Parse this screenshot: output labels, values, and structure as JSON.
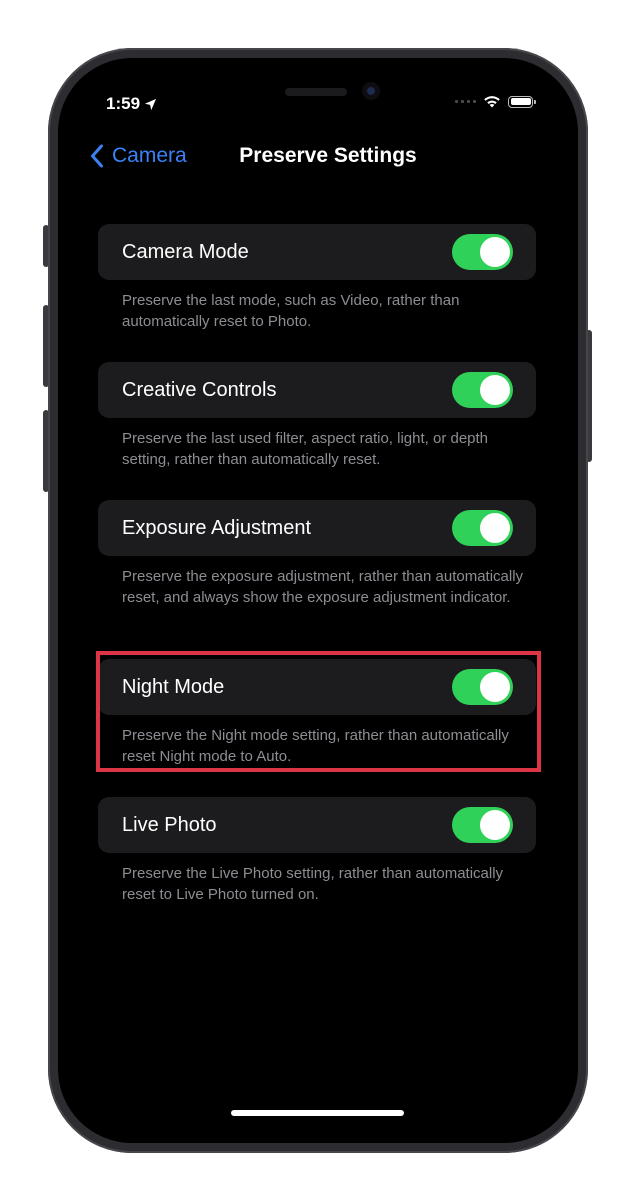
{
  "status_bar": {
    "time": "1:59"
  },
  "nav": {
    "back_label": "Camera",
    "title": "Preserve Settings"
  },
  "settings": [
    {
      "label": "Camera Mode",
      "enabled": true,
      "footer": "Preserve the last mode, such as Video, rather than automatically reset to Photo."
    },
    {
      "label": "Creative Controls",
      "enabled": true,
      "footer": "Preserve the last used filter, aspect ratio, light, or depth setting, rather than automatically reset."
    },
    {
      "label": "Exposure Adjustment",
      "enabled": true,
      "footer": "Preserve the exposure adjustment, rather than automatically reset, and always show the exposure adjustment indicator."
    },
    {
      "label": "Night Mode",
      "enabled": true,
      "highlighted": true,
      "footer": "Preserve the Night mode setting, rather than automatically reset Night mode to Auto."
    },
    {
      "label": "Live Photo",
      "enabled": true,
      "footer": "Preserve the Live Photo setting, rather than automatically reset to Live Photo turned on."
    }
  ],
  "icons": {
    "location": "location-arrow-icon",
    "wifi": "wifi-icon",
    "battery": "battery-icon",
    "back": "chevron-left-icon"
  },
  "colors": {
    "accent": "#3b82f6",
    "toggle_on": "#30d158",
    "highlight": "#dc3545",
    "row_bg": "#1c1c1e",
    "footer_text": "#8d8d93"
  }
}
